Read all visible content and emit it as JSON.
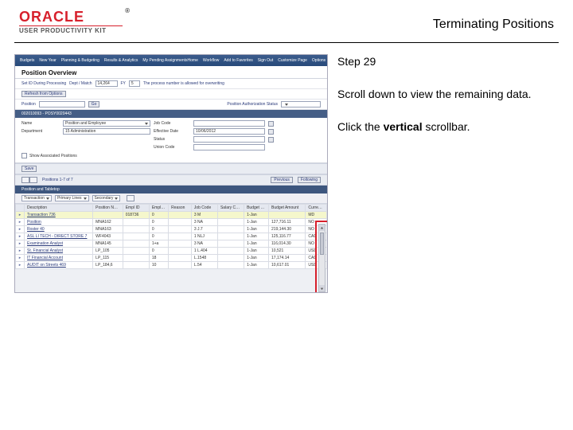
{
  "header": {
    "brand": "ORACLE",
    "product_line": "USER PRODUCTIVITY KIT",
    "title": "Terminating Positions"
  },
  "instructions": {
    "step_label": "Step 29",
    "line1": "Scroll down to view the remaining data.",
    "line2_pre": "Click the ",
    "line2_bold": "vertical",
    "line2_post": " scrollbar."
  },
  "app": {
    "topbar": {
      "left": [
        "Budgets",
        "New Year",
        "Planning & Budgeting",
        "Results & Analytics",
        "My Pending Assignments"
      ],
      "right": [
        "Home",
        "Workflow",
        "Add to Favorites",
        "Sign Out",
        "Customize Page",
        "Options"
      ]
    },
    "page_title": "Position Overview",
    "row1": {
      "setid_label": "Set ID During Processing",
      "dept_label": "Dept / Match",
      "dept_value": "14,264",
      "fy_label": "FY",
      "fy_value": "5",
      "hint": "The process number is allowed for overwriting"
    },
    "refresh_label": "Refresh from Options",
    "row2": {
      "position_label": "Position",
      "go_label": "Go",
      "auth_label": "Position Authorization Status"
    },
    "band1": "002010093 - POSY0020443",
    "details": {
      "name_label": "Name",
      "name_value": "Position and Employee",
      "job_label": "Job Code",
      "job_value": "",
      "dept_label": "Department",
      "dept_value": "15 Administration",
      "eff_label": "Effective Date",
      "eff_value": "10/06/2012",
      "status_label": "Status",
      "status_value": "",
      "union_label": "Union Code",
      "union_value": "",
      "chk_commit": "Show Associated Positions"
    },
    "toolbar": {
      "save_label": "Save",
      "find_label": "Positions   1-7 of 7",
      "prev_label": "Previous",
      "next_label": "Following"
    },
    "band2": "Position and Tabletop",
    "grid_filters": {
      "dropdown1": "Transaction",
      "dropdown2": "Primary Lines",
      "dropdown3": "Secondary"
    },
    "columns": [
      "",
      "Description",
      "Position Number",
      "Empl ID",
      "Empl Rcd",
      "Reason",
      "Job Code",
      "Salary Code",
      "Budget Only",
      "Budget Amount",
      "Currency"
    ],
    "rows": [
      {
        "sel": true,
        "desc": "Transaction 736",
        "pos": "",
        "emp": "018736",
        "rcd": "0",
        "reason": "",
        "job": "3   M",
        "sal": "",
        "bonly": "1-Jan",
        "bamt": "",
        "cur": "MD"
      },
      {
        "sel": false,
        "desc": "Position",
        "pos": "MNA162",
        "emp": "",
        "rcd": "0",
        "reason": "",
        "job": "3   NA",
        "sal": "",
        "bonly": "1-Jan",
        "bamt": "127,716.11",
        "cur": "NO"
      },
      {
        "sel": false,
        "desc": "Roster 40",
        "pos": "MNA163",
        "emp": "",
        "rcd": "0",
        "reason": "",
        "job": "3   J.7",
        "sal": "",
        "bonly": "1-Jan",
        "bamt": "219,144.30",
        "cur": "NO"
      },
      {
        "sel": false,
        "desc": "ASL LI TECH - DIRECT STORE 7",
        "pos": "WF4043",
        "emp": "",
        "rcd": "0",
        "reason": "",
        "job": "1   NLJ",
        "sal": "",
        "bonly": "1-Jan",
        "bamt": "125,116.77",
        "cur": "CAD"
      },
      {
        "sel": false,
        "desc": "Examination Analyst",
        "pos": "MNA145",
        "emp": "",
        "rcd": "1+a",
        "reason": "",
        "job": "3   NA",
        "sal": "",
        "bonly": "1-Jan",
        "bamt": "116,014.30",
        "cur": "NO"
      },
      {
        "sel": false,
        "desc": "St. Financial Analyst",
        "pos": "LP_105",
        "emp": "",
        "rcd": "0",
        "reason": "",
        "job": "1   L.404",
        "sal": "",
        "bonly": "1-Jan",
        "bamt": "10,521",
        "cur": "USD"
      },
      {
        "sel": false,
        "desc": "IT Financial Account",
        "pos": "LP_115",
        "emp": "",
        "rcd": "18",
        "reason": "",
        "job": "L.1548",
        "sal": "",
        "bonly": "1-Jan",
        "bamt": "17,174.14",
        "cur": "CAD"
      },
      {
        "sel": false,
        "desc": "AUDIT on Streets 469",
        "pos": "LP_184,6",
        "emp": "",
        "rcd": "10",
        "reason": "",
        "job": "L.54",
        "sal": "",
        "bonly": "1-Jan",
        "bamt": "10,617.01",
        "cur": "USD"
      }
    ]
  }
}
